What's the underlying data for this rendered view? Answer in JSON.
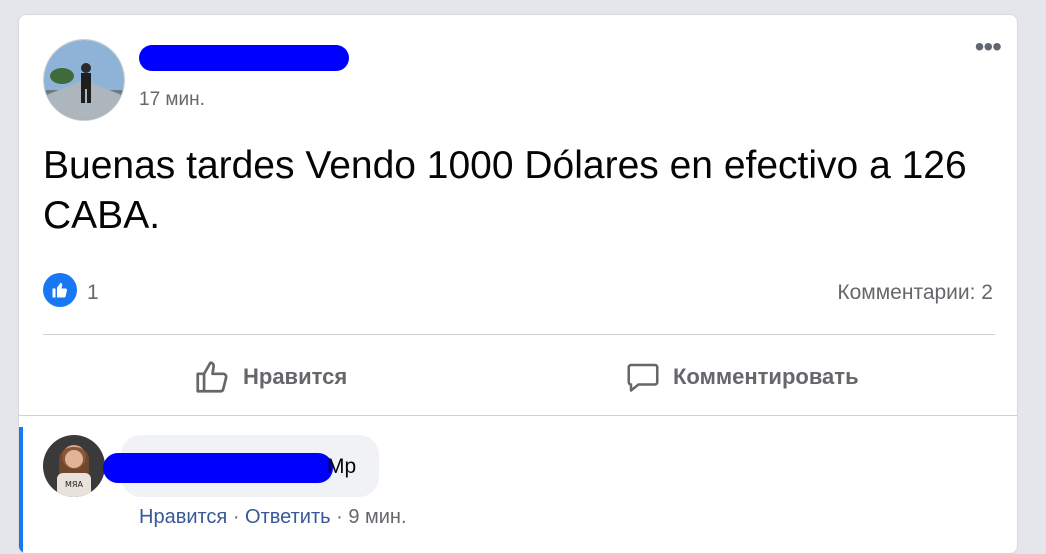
{
  "post": {
    "author": "",
    "timestamp": "17 мин.",
    "text": "Buenas tardes Vendo 1000 Dólares en efectivo a 126 CABA.",
    "likes_count": "1",
    "comments_summary": "Комментарии: 2",
    "more_label": "•••"
  },
  "actions": {
    "like_label": "Нравится",
    "comment_label": "Комментировать"
  },
  "comment": {
    "author": "",
    "text_visible": "Mp",
    "like_label": "Нравится",
    "sep1": " · ",
    "reply_label": "Ответить",
    "sep2": " · ",
    "time": "9 мин.",
    "avatar_print": "MЯA"
  },
  "colors": {
    "accent": "#1877f2",
    "redaction": "#0000ff",
    "muted_text": "#65676b"
  }
}
